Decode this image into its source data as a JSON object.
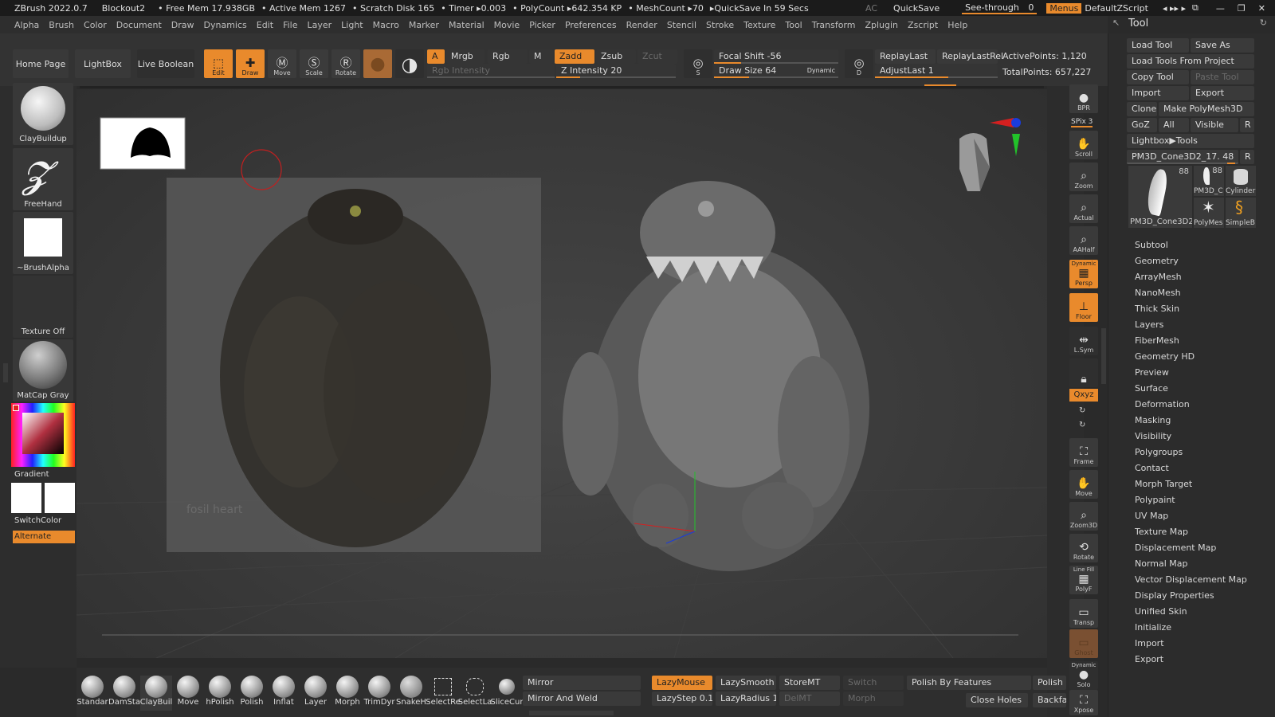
{
  "titlebar": {
    "app": "ZBrush 2022.0.7",
    "doc": "Blockout2",
    "free_mem": "• Free Mem 17.938GB",
    "active_mem": "• Active Mem 1267",
    "scratch": "• Scratch Disk 165",
    "timer": "• Timer ▸0.003",
    "polycount": "• PolyCount ▸642.354 KP",
    "meshcount": "• MeshCount ▸70",
    "quicksave": "▸QuickSave In 59 Secs",
    "ac": "AC",
    "quicksave_btn": "QuickSave",
    "seethrough": "See-through",
    "seethrough_val": "0",
    "menus": "Menus",
    "script": "DefaultZScript"
  },
  "menubar": [
    "Alpha",
    "Brush",
    "Color",
    "Document",
    "Draw",
    "Dynamics",
    "Edit",
    "File",
    "Layer",
    "Light",
    "Macro",
    "Marker",
    "Material",
    "Movie",
    "Picker",
    "Preferences",
    "Render",
    "Stencil",
    "Stroke",
    "Texture",
    "Tool",
    "Transform",
    "Zplugin",
    "Zscript",
    "Help"
  ],
  "toolbar": {
    "home": "Home Page",
    "lightbox": "LightBox",
    "live_boolean": "Live Boolean",
    "edit": "Edit",
    "draw": "Draw",
    "move": "Move",
    "scale": "Scale",
    "rotate": "Rotate",
    "a": "A",
    "mrgb": "Mrgb",
    "rgb": "Rgb",
    "m": "M",
    "zadd": "Zadd",
    "zsub": "Zsub",
    "zcut": "Zcut",
    "rgb_intensity": "Rgb Intensity",
    "z_intensity": "Z Intensity 20",
    "focal_shift": "Focal Shift -56",
    "draw_size": "Draw Size 64",
    "dynamic": "Dynamic",
    "replay_last": "ReplayLast",
    "replay_last_rel": "ReplayLastRel",
    "adjust_last": "AdjustLast 1",
    "active_points": "ActivePoints: 1,120",
    "total_points": "TotalPoints: 657,227",
    "s_label": "S",
    "d_label": "D",
    "z_intensity_pct": 20,
    "focal_shift_pct": 22,
    "draw_size_pct": 28,
    "adjust_last_pct": 60
  },
  "leftshelf": {
    "brush": "ClayBuildup",
    "stroke": "FreeHand",
    "alpha": "~BrushAlpha",
    "texture": "Texture Off",
    "material": "MatCap Gray",
    "gradient": "Gradient",
    "switchcolor": "SwitchColor",
    "alternate": "Alternate"
  },
  "rightshelf": {
    "bpr": "BPR",
    "spix": "SPix 3",
    "scroll": "Scroll",
    "zoom": "Zoom",
    "actual": "Actual",
    "aahalf": "AAHalf",
    "dynamic": "Dynamic",
    "persp": "Persp",
    "floor": "Floor",
    "lsym": "L.Sym",
    "xyz": "Qxyz",
    "frame": "Frame",
    "move": "Move",
    "zoom3d": "Zoom3D",
    "rotate": "Rotate",
    "linefill": "Line Fill",
    "polyf": "PolyF",
    "transp": "Transp",
    "ghost": "Ghost",
    "dynamic2": "Dynamic",
    "solo": "Solo",
    "xpose": "Xpose"
  },
  "toolpanel": {
    "title": "Tool",
    "load_tool": "Load Tool",
    "save_as": "Save As",
    "load_from_project": "Load Tools From Project",
    "copy_tool": "Copy Tool",
    "paste_tool": "Paste Tool",
    "import": "Import",
    "export": "Export",
    "clone": "Clone",
    "make_polymesh": "Make PolyMesh3D",
    "goz": "GoZ",
    "all": "All",
    "visible": "Visible",
    "r": "R",
    "lightbox_tools": "Lightbox▶Tools",
    "current_tool": "PM3D_Cone3D2_17. 48",
    "thumb_main": "PM3D_Cone3D2",
    "thumb_main_count": "88",
    "thumb_2": "PM3D_C",
    "thumb_2_count": "88",
    "thumb_3": "Cylinder",
    "thumb_4": "PolyMes",
    "thumb_5": "SimpleB",
    "subpalettes": [
      "Subtool",
      "Geometry",
      "ArrayMesh",
      "NanoMesh",
      "Thick Skin",
      "Layers",
      "FiberMesh",
      "Geometry HD",
      "Preview",
      "Surface",
      "Deformation",
      "Masking",
      "Visibility",
      "Polygroups",
      "Contact",
      "Morph Target",
      "Polypaint",
      "UV Map",
      "Texture Map",
      "Displacement Map",
      "Normal Map",
      "Vector Displacement Map",
      "Display Properties",
      "Unified Skin",
      "Initialize",
      "Import",
      "Export"
    ]
  },
  "bottombar": {
    "brushes": [
      "Standar",
      "DamSta",
      "ClayBuil",
      "Move",
      "hPolish",
      "Polish",
      "Inflat",
      "Layer",
      "Morph",
      "TrimDyr",
      "SnakeH",
      "SelectRe",
      "SelectLa",
      "SliceCur"
    ],
    "mirror": "Mirror",
    "mirror_weld": "Mirror And Weld",
    "lazymouse": "LazyMouse",
    "lazystep": "LazyStep 0.1",
    "lazysmooth": "LazySmooth 0",
    "lazyradius": "LazyRadius 1",
    "storemt": "StoreMT",
    "delmt": "DelMT",
    "switch": "Switch",
    "morph": "Morph",
    "polish_features": "Polish By Features",
    "polish": "Polish",
    "close_holes": "Close Holes",
    "backface": "Backfac"
  },
  "viewport": {
    "ref_text": "fosil heart",
    "colors": {
      "accent": "#e98a2c",
      "bg": "#3a3a3a",
      "axis_red": "#d42020",
      "axis_green": "#22c22a",
      "axis_blue": "#1a3cdd"
    }
  }
}
